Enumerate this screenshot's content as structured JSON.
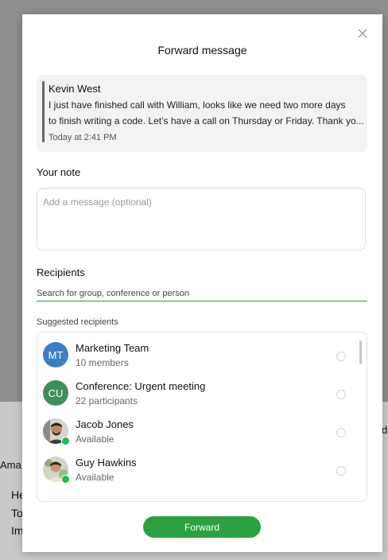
{
  "background": {
    "fragment_left": "Ama",
    "fragment_right": "d",
    "lines": [
      "He",
      "To",
      "Im"
    ]
  },
  "modal": {
    "title": "Forward message",
    "close_icon": "close-icon"
  },
  "quoted_message": {
    "author": "Kevin West",
    "line1": "I just have finished call with William, looks like we need two more  days",
    "line2": "to finish writing a code. Let’s have a call on Thursday or Friday. Thank yo...",
    "time": "Today at 2:41 PM"
  },
  "note": {
    "label": "Your note",
    "placeholder": "Add a message (optional)",
    "value": ""
  },
  "recipients": {
    "label": "Recipients",
    "search_placeholder": "Search for group, conference or person",
    "suggested_label": "Suggested recipients",
    "items": [
      {
        "name": "Marketing Team",
        "subtitle": "10 members",
        "initials": "MT",
        "avatar_color": "#3a7fc6",
        "online": false
      },
      {
        "name": "Conference: Urgent meeting",
        "subtitle": "22 participants",
        "initials": "CU",
        "avatar_color": "#3f8f5c",
        "online": false
      },
      {
        "name": "Jacob Jones",
        "subtitle": "Available",
        "initials": "",
        "avatar_color": "#6d5a4a",
        "online": true
      },
      {
        "name": "Guy Hawkins",
        "subtitle": "Available",
        "initials": "",
        "avatar_color": "#7a9a6a",
        "online": true
      }
    ]
  },
  "actions": {
    "forward_label": "Forward",
    "primary_color": "#2ba141"
  }
}
